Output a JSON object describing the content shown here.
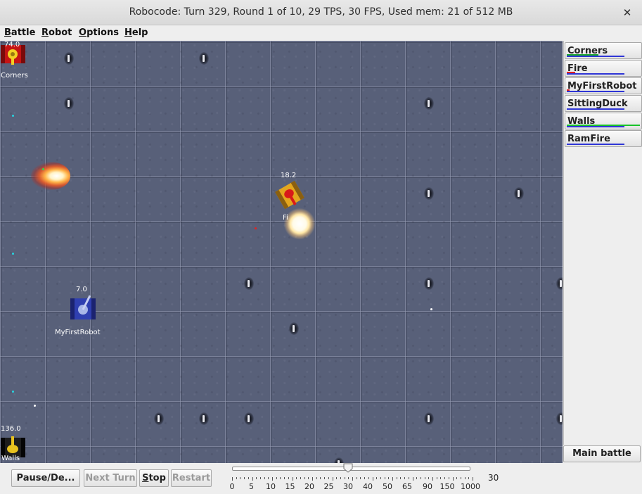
{
  "window": {
    "title": "Robocode: Turn 329, Round 1 of 10, 29 TPS, 30 FPS, Used mem: 21 of 512 MB",
    "close_icon": "✕"
  },
  "menu": {
    "items": [
      {
        "mnemonic": "B",
        "rest": "attle"
      },
      {
        "mnemonic": "R",
        "rest": "obot"
      },
      {
        "mnemonic": "O",
        "rest": "ptions"
      },
      {
        "mnemonic": "H",
        "rest": "elp"
      }
    ]
  },
  "arena": {
    "robots": [
      {
        "name": "Corners",
        "energy": "74.0",
        "color": "red"
      },
      {
        "name": "Fi",
        "energy": "18.2",
        "color": "yellow"
      },
      {
        "name": "MyFirstRobot",
        "energy": "7.0",
        "color": "blue"
      },
      {
        "name": "Walls",
        "energy": "136.0",
        "color": "black-yellow"
      }
    ]
  },
  "robot_panel": {
    "robots": [
      {
        "name": "Corners",
        "energy_fraction": 0.43,
        "gun_fraction": 0.98,
        "energy_color": "#19a62a",
        "gun_color": "#2f36d6"
      },
      {
        "name": "Fire",
        "energy_fraction": 0.12,
        "gun_fraction": 0.98,
        "energy_color": "#e02020",
        "gun_color": "#2f36d6"
      },
      {
        "name": "MyFirstRobot",
        "energy_fraction": 0.04,
        "gun_fraction": 0.98,
        "energy_color": "#e02020",
        "gun_color": "#2f36d6"
      },
      {
        "name": "SittingDuck",
        "energy_fraction": 0.0,
        "gun_fraction": 0.98,
        "energy_color": "#19a62a",
        "gun_color": "#2f36d6"
      },
      {
        "name": "Walls",
        "energy_fraction": 1.0,
        "gun_fraction": 0.98,
        "energy_color": "#19c22a",
        "gun_color": "#2f36d6"
      },
      {
        "name": "RamFire",
        "energy_fraction": 0.0,
        "gun_fraction": 0.98,
        "energy_color": "#19a62a",
        "gun_color": "#2f36d6"
      }
    ],
    "battle_log_label": "Main battle log"
  },
  "toolbar": {
    "pause_label": "Pause/De...",
    "next_turn_label": "Next Turn",
    "stop_mnemonic": "S",
    "stop_rest": "top",
    "restart_label": "Restart",
    "tps_value": "30",
    "tps_ticks": [
      "0",
      "5",
      "10",
      "15",
      "20",
      "25",
      "30",
      "40",
      "50",
      "65",
      "90",
      "150",
      "1000"
    ],
    "tps_selected": "30"
  }
}
